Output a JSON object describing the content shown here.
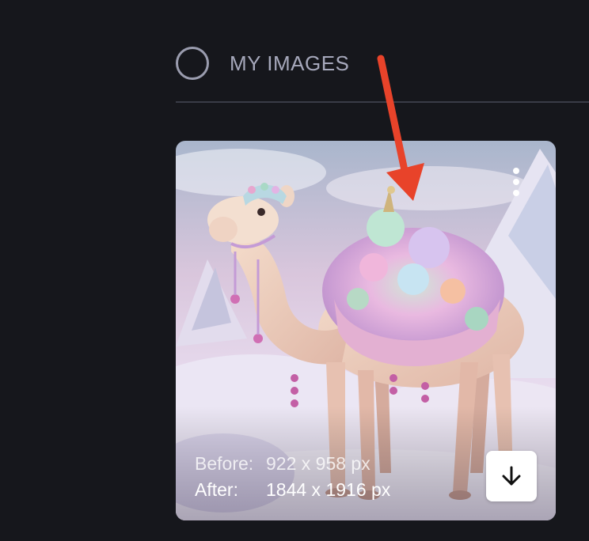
{
  "section": {
    "title": "MY IMAGES"
  },
  "image_card": {
    "before_label": "Before:",
    "before_value": "922 x 958 px",
    "after_label": "After:",
    "after_value": "1844 x 1916 px",
    "menu_icon": "more-vertical-icon",
    "download_icon": "arrow-down-icon"
  },
  "colors": {
    "background": "#16171c",
    "annotation_arrow": "#e8432a"
  }
}
